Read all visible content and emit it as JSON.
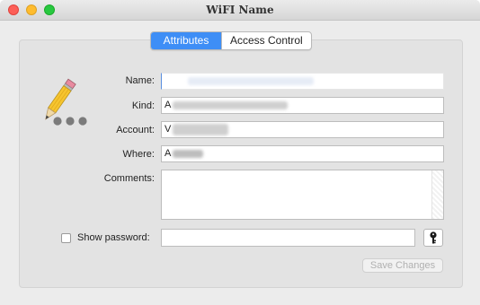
{
  "window": {
    "title": "WiFI Name"
  },
  "tabs": [
    {
      "label": "Attributes",
      "active": true
    },
    {
      "label": "Access Control",
      "active": false
    }
  ],
  "form": {
    "name_label": "Name:",
    "kind_label": "Kind:",
    "kind_value_visible": "A",
    "account_label": "Account:",
    "account_value_visible": "V",
    "where_label": "Where:",
    "where_value_visible": "A",
    "comments_label": "Comments:",
    "show_password_label": "Show password:",
    "show_password_checked": false,
    "save_button_label": "Save Changes"
  },
  "icons": {
    "item_icon": "pencil-ellipsis-icon",
    "key_icon": "key-icon"
  },
  "colors": {
    "accent": "#3e8ef6",
    "close": "#fd5f57",
    "minimize": "#febc2e",
    "zoom": "#28c840"
  }
}
